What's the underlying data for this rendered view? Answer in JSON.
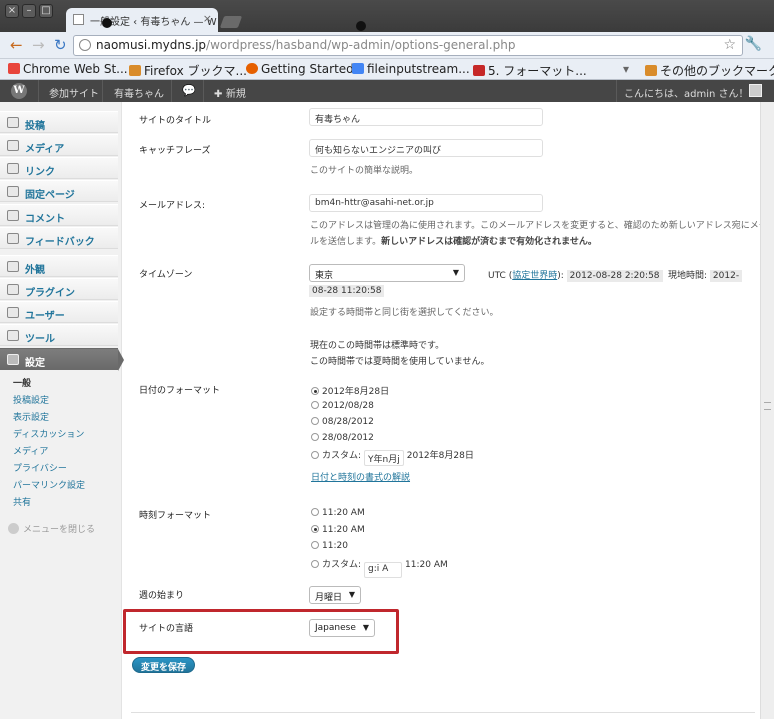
{
  "browser": {
    "tab_title": "一般設定 ‹ 有毒ちゃん — W",
    "url_host": "naomusi.mydns.jp",
    "url_path": "/wordpress/hasband/wp-admin/options-general.php",
    "bookmarks": [
      {
        "label": "Chrome Web St...",
        "icon": "chrome-webstore-icon",
        "color": "#e8453c"
      },
      {
        "label": "Firefox ブックマ...",
        "icon": "folder-icon",
        "color": "#d98c2b"
      },
      {
        "label": "Getting Started",
        "icon": "firefox-icon",
        "color": "#e66000"
      },
      {
        "label": "fileinputstream...",
        "icon": "google-icon",
        "color": "#4285f4"
      },
      {
        "label": "5. フォーマット...",
        "icon": "bookmark-icon",
        "color": "#c62828"
      }
    ],
    "other_bookmarks": "その他のブックマーク"
  },
  "adminbar": {
    "items": [
      "参加サイト",
      "有毒ちゃん"
    ],
    "new_label": "新規",
    "greeting": "こんにちは、admin さん！"
  },
  "sidebar": {
    "menu": [
      {
        "label": "投稿",
        "icon": "pin-icon"
      },
      {
        "label": "メディア",
        "icon": "media-icon"
      },
      {
        "label": "リンク",
        "icon": "link-icon"
      },
      {
        "label": "固定ページ",
        "icon": "page-icon"
      },
      {
        "label": "コメント",
        "icon": "comment-icon"
      },
      {
        "label": "フィードバック",
        "icon": "feedback-icon"
      },
      {
        "label": "外観",
        "icon": "appearance-icon"
      },
      {
        "label": "プラグイン",
        "icon": "plugin-icon"
      },
      {
        "label": "ユーザー",
        "icon": "users-icon"
      },
      {
        "label": "ツール",
        "icon": "tools-icon"
      },
      {
        "label": "設定",
        "icon": "settings-icon"
      }
    ],
    "submenu": [
      "一般",
      "投稿設定",
      "表示設定",
      "ディスカッション",
      "メディア",
      "プライバシー",
      "パーマリンク設定",
      "共有"
    ],
    "collapse": "メニューを閉じる"
  },
  "form": {
    "site_title_label": "サイトのタイトル",
    "site_title_value": "有毒ちゃん",
    "tagline_label": "キャッチフレーズ",
    "tagline_value": "何も知らないエンジニアの叫び",
    "tagline_desc": "このサイトの簡単な説明。",
    "email_label": "メールアドレス:",
    "email_value": "bm4n-httr@asahi-net.or.jp",
    "email_desc_1": "このアドレスは管理の為に使用されます。このメールアドレスを変更すると、確認のため新しいアドレス宛にメー",
    "email_desc_2a": "ルを送信します。",
    "email_desc_2b": "新しいアドレスは確認が済むまで有効化されません。",
    "timezone_label": "タイムゾーン",
    "timezone_value": "東京",
    "utc_prefix": "UTC (",
    "utc_link": "協定世界時",
    "utc_suffix": "):",
    "utc_time": "2012-08-28 2:20:58",
    "local_label": "現地時間:",
    "local_time_a": "2012-",
    "local_time_b": "08-28 11:20:58",
    "timezone_desc": "設定する時間帯と同じ街を選択してください。",
    "tz_note_1": "現在のこの時間帯は標準時です。",
    "tz_note_2": "この時間帯では夏時間を使用していません。",
    "date_format_label": "日付のフォーマット",
    "date_options": [
      "2012年8月28日",
      "2012/08/28",
      "08/28/2012",
      "28/08/2012"
    ],
    "date_custom_label": "カスタム:",
    "date_custom_value": "Y年n月j",
    "date_custom_preview": "2012年8月28日",
    "date_doc_link": "日付と時刻の書式の解説",
    "time_format_label": "時刻フォーマット",
    "time_options": [
      "11:20 AM",
      "11:20 AM",
      "11:20"
    ],
    "time_custom_label": "カスタム:",
    "time_custom_value": "g:i A",
    "time_custom_preview": "11:20 AM",
    "week_start_label": "週の始まり",
    "week_start_value": "月曜日",
    "language_label": "サイトの言語",
    "language_value": "Japanese",
    "save_label": "変更を保存"
  }
}
